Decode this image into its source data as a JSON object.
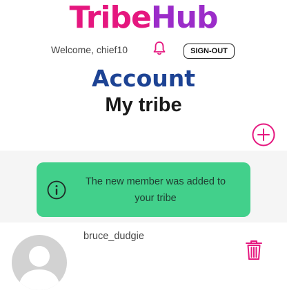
{
  "app": {
    "logo_part1": "Tribe",
    "logo_part2": "Hub"
  },
  "header": {
    "welcome_text": "Welcome, chief10",
    "signout_label": "SIGN-OUT",
    "bell_icon": "bell-icon"
  },
  "page": {
    "title": "Account",
    "subtitle": "My tribe",
    "add_icon": "plus-circle-icon"
  },
  "alert": {
    "icon": "info-icon",
    "message": "The new member was added to your tribe"
  },
  "members": [
    {
      "username": "bruce_dudgie",
      "avatar_icon": "default-avatar-icon",
      "delete_icon": "trash-icon"
    }
  ],
  "colors": {
    "logo_pink": "#e5177f",
    "logo_purple": "#9b2cc9",
    "title_blue": "#1d4394",
    "accent_pink": "#e5177f",
    "success_green": "#42d08b"
  }
}
